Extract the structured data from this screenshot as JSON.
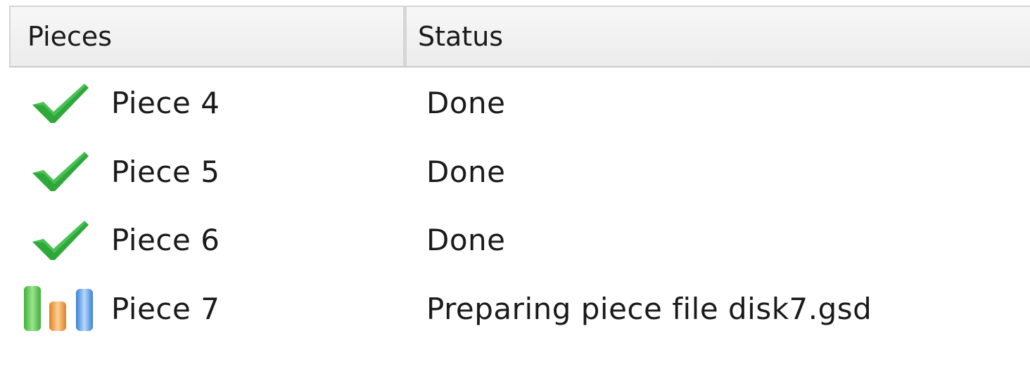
{
  "columns": {
    "pieces": "Pieces",
    "status": "Status"
  },
  "rows": [
    {
      "icon": "checkmark-icon",
      "piece": "Piece 4",
      "status": "Done"
    },
    {
      "icon": "checkmark-icon",
      "piece": "Piece 5",
      "status": "Done"
    },
    {
      "icon": "checkmark-icon",
      "piece": "Piece 6",
      "status": "Done"
    },
    {
      "icon": "progress-bars-icon",
      "piece": "Piece 7",
      "status": "Preparing piece file disk7.gsd"
    }
  ],
  "colors": {
    "check_green": "#2fa83a",
    "bar_green": "#5cc44e",
    "bar_orange": "#f2a04a",
    "bar_blue": "#5a9de0"
  }
}
